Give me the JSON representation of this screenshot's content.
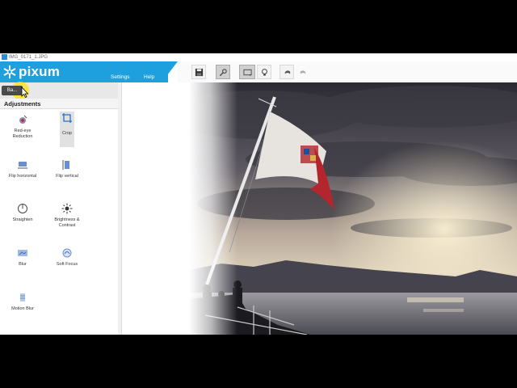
{
  "window": {
    "title": "IMG_0171_1.JPG"
  },
  "brand": {
    "name": "pixum",
    "color": "#1ea0df"
  },
  "menu": {
    "settings": "Settings",
    "help": "Help"
  },
  "toolbar": {
    "buttons": [
      {
        "name": "save-icon"
      },
      {
        "name": "edit-tools-icon",
        "active": true
      },
      {
        "name": "frame-icon",
        "active": true
      },
      {
        "name": "lightbulb-icon"
      },
      {
        "name": "undo-icon"
      },
      {
        "name": "redo-icon"
      }
    ]
  },
  "panel": {
    "back_label": "Ba...",
    "heading": "Adjustments",
    "tools": [
      {
        "label": "Red-eye Reduction",
        "icon": "eye-icon"
      },
      {
        "label": "Crop",
        "icon": "crop-icon",
        "selected": true
      },
      {
        "label": "Flip horizontal",
        "icon": "flip-horizontal-icon"
      },
      {
        "label": "Flip vertical",
        "icon": "flip-vertical-icon"
      },
      {
        "label": "Straighten",
        "icon": "straighten-icon"
      },
      {
        "label": "Brightness & Contrast",
        "icon": "brightness-icon"
      },
      {
        "label": "Blur",
        "icon": "blur-icon"
      },
      {
        "label": "Soft Focus",
        "icon": "soft-focus-icon"
      },
      {
        "label": "Motion Blur",
        "icon": "motion-blur-icon"
      }
    ]
  },
  "colors": {
    "accent": "#1ea0df",
    "highlight": "#ffe600",
    "flag_green": "#2f6b3a",
    "flag_red": "#b3262e"
  }
}
